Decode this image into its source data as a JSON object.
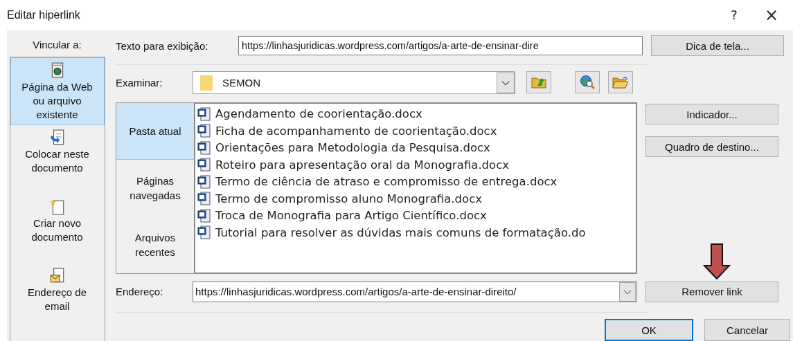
{
  "window": {
    "title": "Editar hiperlink",
    "help": "?",
    "close": "×"
  },
  "link_to": {
    "label": "Vincular a:",
    "items": [
      {
        "label": "Página da Web ou arquivo existente",
        "kind": "web",
        "selected": true
      },
      {
        "label": "Colocar neste documento",
        "kind": "place",
        "selected": false
      },
      {
        "label": "Criar novo documento",
        "kind": "new",
        "selected": false
      },
      {
        "label": "Endereço de email",
        "kind": "email",
        "selected": false
      }
    ]
  },
  "display_text": {
    "label": "Texto para exibição:",
    "value": "https://linhasjuridicas.wordpress.com/artigos/a-arte-de-ensinar-dire"
  },
  "screen_tip_button": "Dica de tela...",
  "browse": {
    "label": "Examinar:",
    "value": "SEMON"
  },
  "browse_tabs": [
    {
      "label": "Pasta atual",
      "selected": true
    },
    {
      "label": "Páginas navegadas",
      "selected": false
    },
    {
      "label": "Arquivos recentes",
      "selected": false
    }
  ],
  "files": [
    "Agendamento de coorientação.docx",
    "Ficha de acompanhamento de coorientação.docx",
    "Orientações para Metodologia da Pesquisa.docx",
    "Roteiro para apresentação oral da Monografia.docx",
    "Termo de ciência de atraso e compromisso de entrega.docx",
    "Termo de compromisso aluno Monografia.docx",
    "Troca de Monografia para Artigo Científico.docx",
    "Tutorial para resolver as dúvidas mais comuns de formatação.do"
  ],
  "side_buttons": [
    "Indicador...",
    "Quadro de destino..."
  ],
  "address": {
    "label": "Endereço:",
    "value": "https://linhasjuridicas.wordpress.com/artigos/a-arte-de-ensinar-direito/"
  },
  "remove_link_button": "Remover link",
  "buttons": [
    {
      "label": "OK",
      "default": true
    },
    {
      "label": "Cancelar",
      "default": false
    }
  ]
}
